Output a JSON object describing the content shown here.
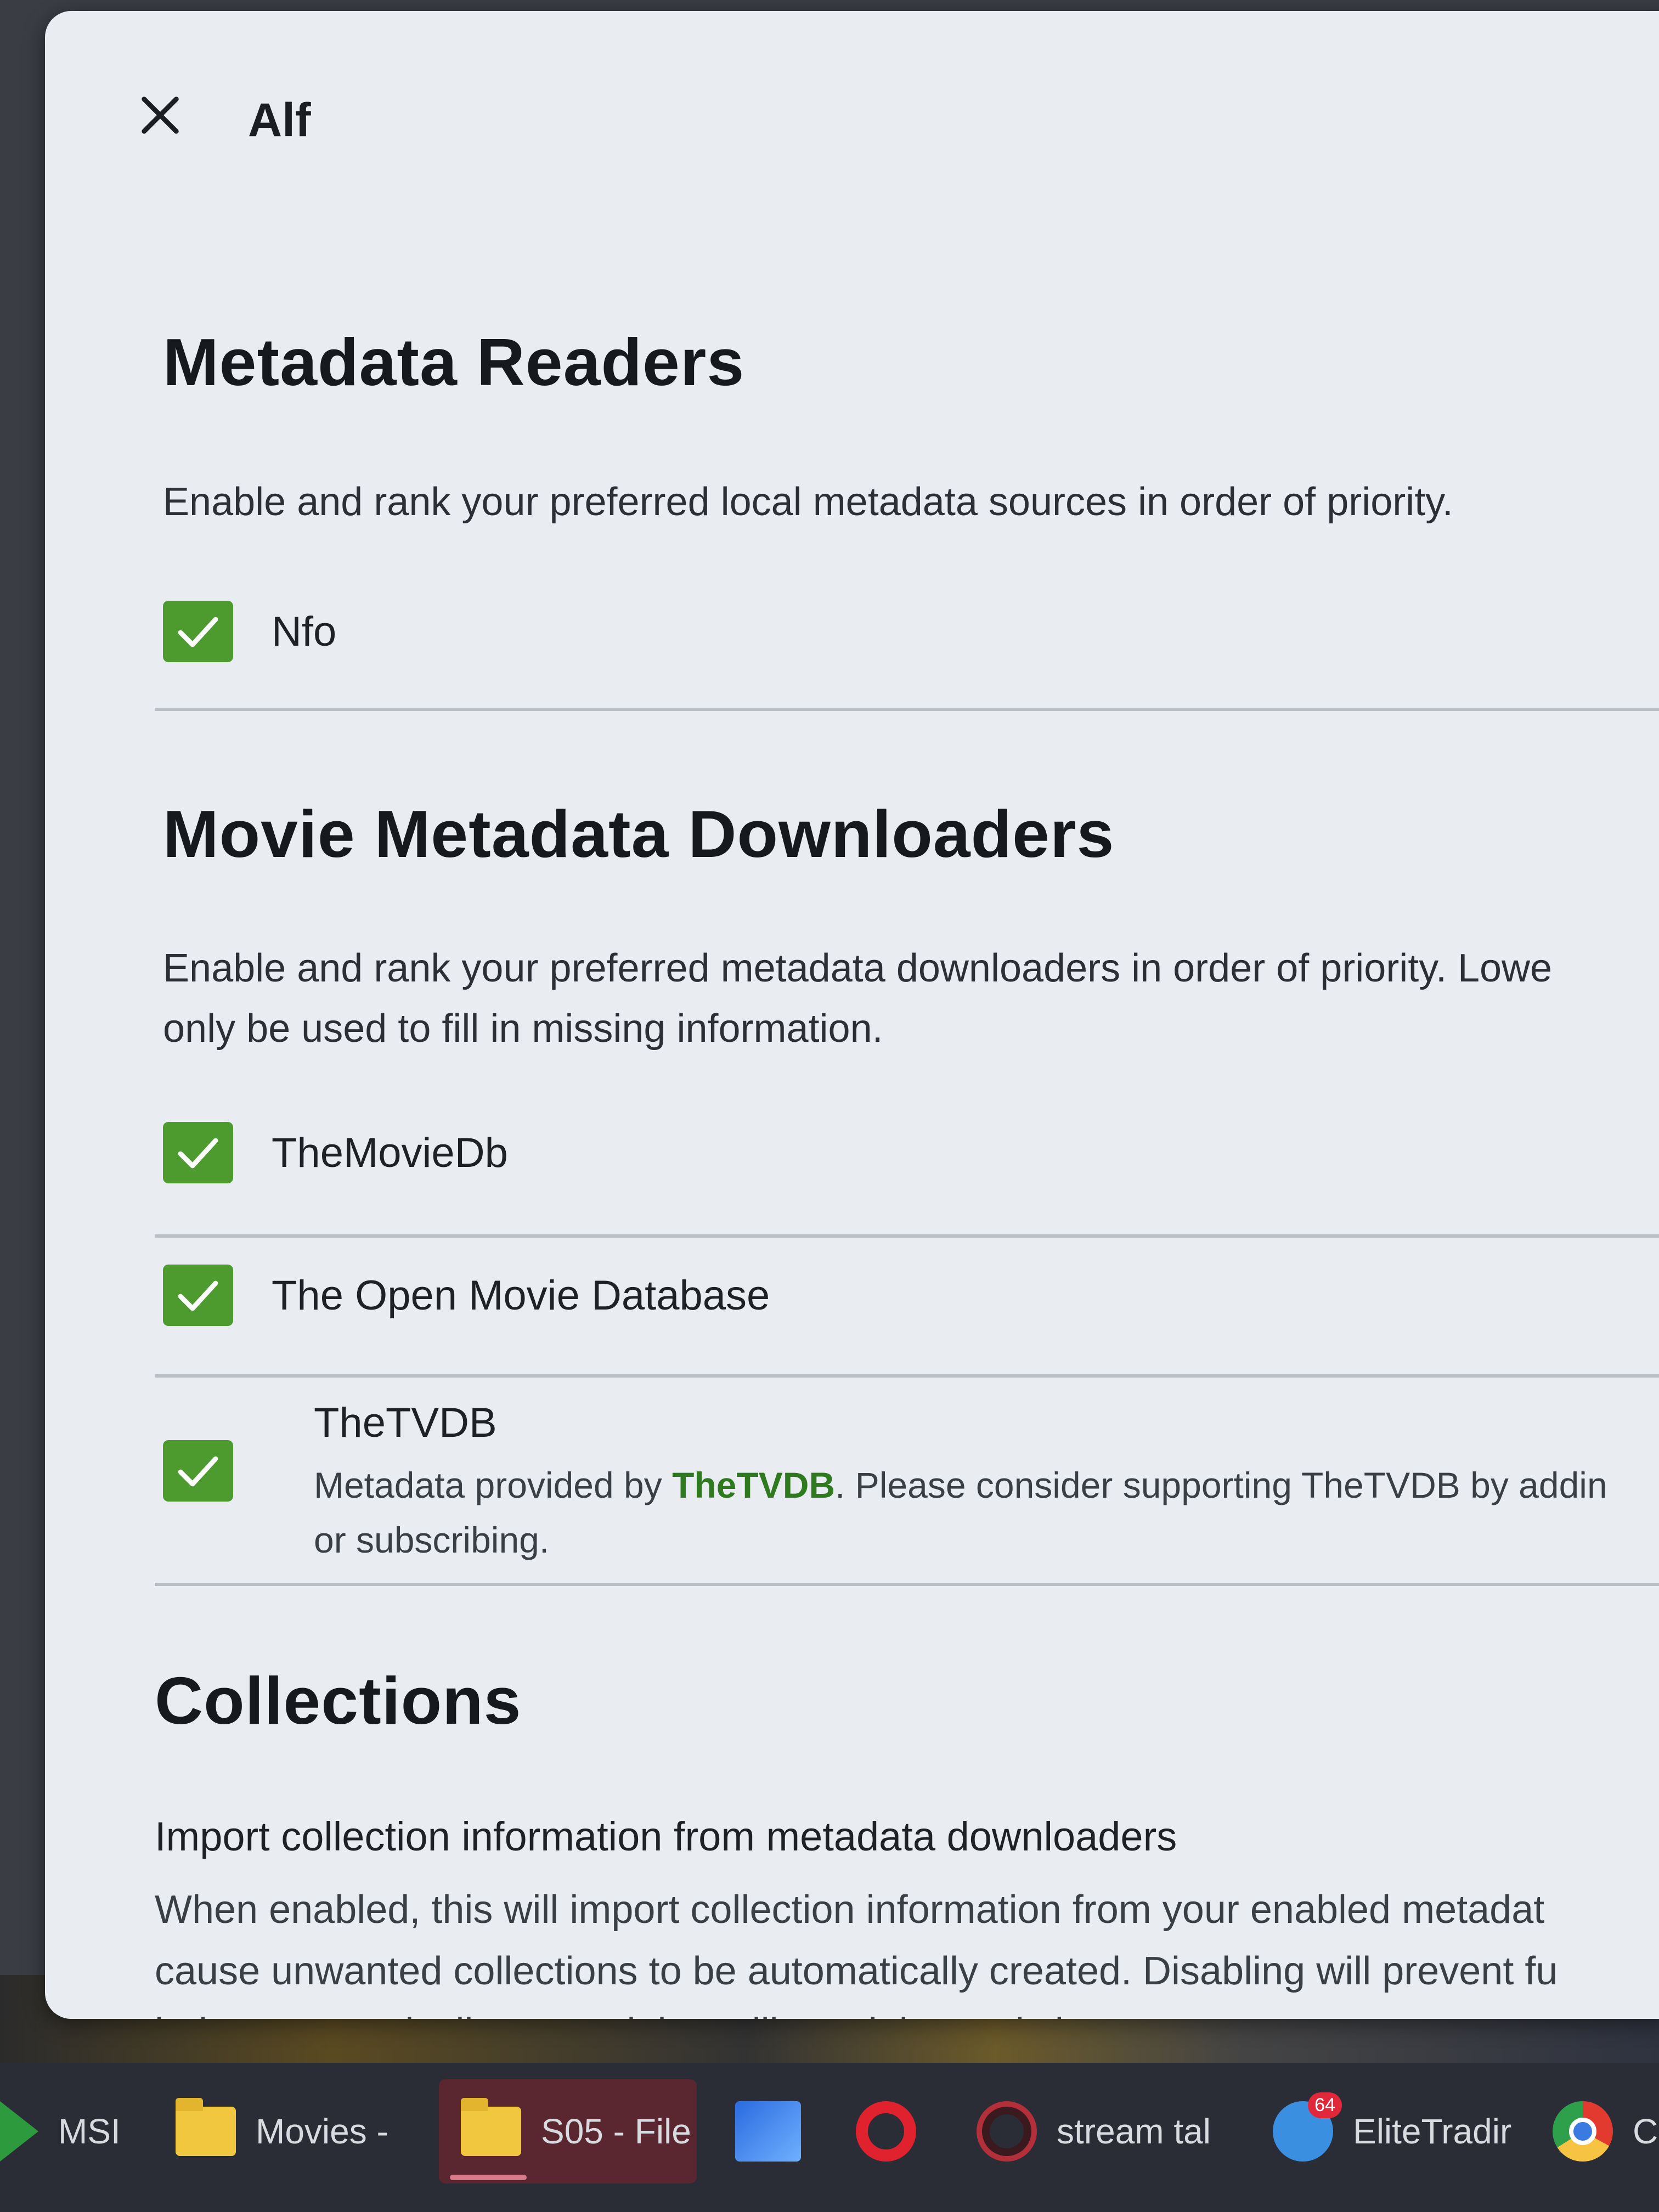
{
  "dialog": {
    "title": "Alf"
  },
  "metadata_readers": {
    "title": "Metadata Readers",
    "description": "Enable and rank your preferred local metadata sources in order of priority.",
    "items": [
      {
        "label": "Nfo",
        "checked": true
      }
    ]
  },
  "movie_downloaders": {
    "title": "Movie Metadata Downloaders",
    "description_line1": "Enable and rank your preferred metadata downloaders in order of priority. Lowe",
    "description_line2": "only be used to fill in missing information.",
    "items": [
      {
        "label": "TheMovieDb",
        "checked": true
      },
      {
        "label": "The Open Movie Database",
        "checked": true
      },
      {
        "label": "TheTVDB",
        "checked": true
      }
    ],
    "tvdb_note_prefix": "Metadata provided by ",
    "tvdb_note_link": "TheTVDB",
    "tvdb_note_suffix": ". Please consider supporting TheTVDB by addin",
    "tvdb_note_line2": "or subscribing."
  },
  "collections": {
    "title": "Collections",
    "subtitle": "Import collection information from metadata downloaders",
    "description_line1": "When enabled, this will import collection information from your enabled metadat",
    "description_line2": "cause unwanted collections to be automatically created. Disabling will prevent fu",
    "description_line3": "being automatically created, but will not delete existing ones."
  },
  "taskbar": {
    "items": [
      {
        "label": "MSI",
        "icon": "msi-icon"
      },
      {
        "label": "Movies -",
        "icon": "folder-icon"
      },
      {
        "label": "S05 - File",
        "icon": "folder-icon",
        "active": true
      },
      {
        "label": "",
        "icon": "network-icon"
      },
      {
        "label": "",
        "icon": "opera-icon"
      },
      {
        "label": "stream tal",
        "icon": "opera-gx-icon"
      },
      {
        "label": "EliteTradir",
        "icon": "telegram-icon",
        "badge": "64"
      },
      {
        "label": "C",
        "icon": "chrome-icon"
      }
    ]
  },
  "colors": {
    "checkbox": "#4d9b2e",
    "link": "#2f7a1e",
    "dialog_bg": "#e9edf1",
    "taskbar_bg": "#2a2d35"
  }
}
